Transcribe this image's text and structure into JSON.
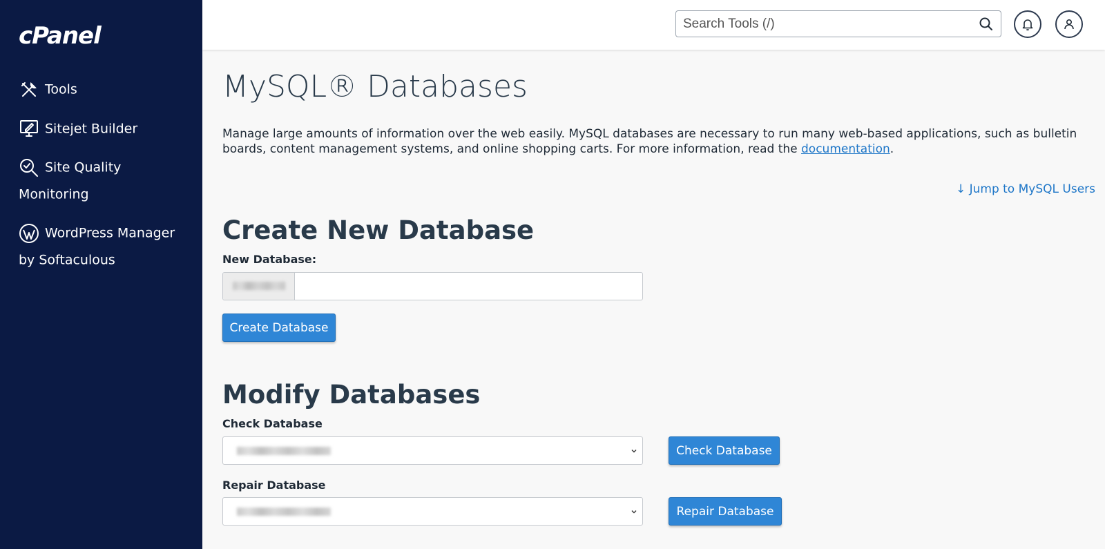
{
  "sidebar": {
    "logo": "cPanel",
    "items": [
      {
        "label": "Tools",
        "icon": "tools-icon"
      },
      {
        "label": "Sitejet Builder",
        "icon": "monitor-edit-icon"
      },
      {
        "label": "Site Quality Monitoring",
        "icon": "magnifier-check-icon"
      },
      {
        "label": "WordPress Manager by Softaculous",
        "icon": "wordpress-icon"
      }
    ]
  },
  "topbar": {
    "search_placeholder": "Search Tools (/)",
    "icons": [
      "search-icon",
      "bell-icon",
      "user-icon"
    ]
  },
  "main": {
    "title": "MySQL® Databases",
    "description_text": "Manage large amounts of information over the web easily. MySQL databases are necessary to run many web-based applications, such as bulletin boards, content management systems, and online shopping carts. For more information, read the ",
    "description_link": "documentation",
    "description_end": ".",
    "jump_link": "↓ Jump to MySQL Users",
    "create": {
      "title": "Create New Database",
      "label": "New Database:",
      "input_value": "",
      "button": "Create Database"
    },
    "modify": {
      "title": "Modify Databases",
      "check_label": "Check Database",
      "check_button": "Check Database",
      "repair_label": "Repair Database",
      "repair_button": "Repair Database"
    }
  },
  "colors": {
    "sidebar_bg": "#0b1a44",
    "accent": "#2f86d6",
    "link": "#1f77c8"
  }
}
